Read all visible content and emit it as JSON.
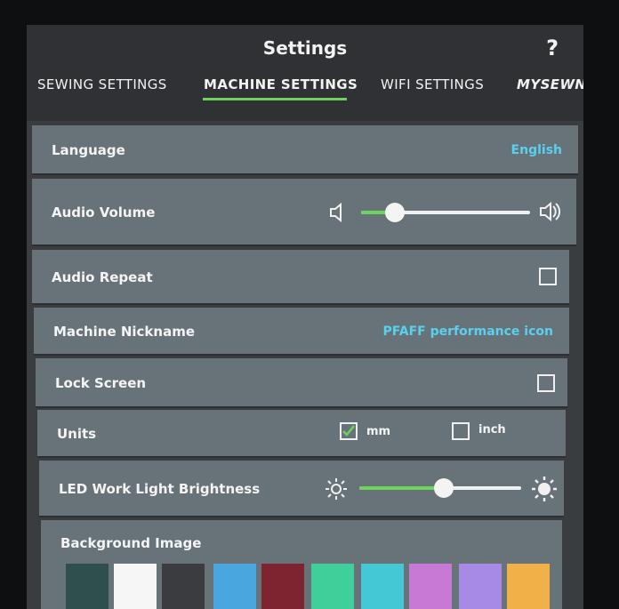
{
  "header": {
    "title": "Settings",
    "help_label": "?"
  },
  "tabs": [
    {
      "label": "SEWING SETTINGS"
    },
    {
      "label": "MACHINE SETTINGS",
      "active": true
    },
    {
      "label": "WIFI SETTINGS"
    },
    {
      "label": "MYSEWN"
    }
  ],
  "settings": {
    "language": {
      "label": "Language",
      "value": "English"
    },
    "audio_volume": {
      "label": "Audio Volume",
      "level": 0.2
    },
    "audio_repeat": {
      "label": "Audio Repeat",
      "checked": false
    },
    "machine_nickname": {
      "label": "Machine Nickname",
      "value": "PFAFF performance icon"
    },
    "lock_screen": {
      "label": "Lock Screen",
      "checked": false
    },
    "units": {
      "label": "Units",
      "options": [
        {
          "label": "mm",
          "checked": true
        },
        {
          "label": "inch",
          "checked": false
        }
      ]
    },
    "led_brightness": {
      "label": "LED Work Light Brightness",
      "level": 0.52
    },
    "background_image": {
      "label": "Background Image"
    }
  },
  "swatches": [
    "#2e4f4c",
    "#f6f6f6",
    "#3a3c3f",
    "#4aa6df",
    "#7e2330",
    "#3fcf9a",
    "#45c8d6",
    "#c67ad6",
    "#a78ae6",
    "#f0b248"
  ],
  "icons": {
    "speaker_low": "speaker-low-icon",
    "speaker_high": "speaker-high-icon",
    "brightness_low": "sun-low-icon",
    "brightness_high": "sun-high-icon"
  },
  "colors": {
    "accent": "#6cd45a",
    "value_text": "#5ad0ef",
    "row_bg": "#687379"
  }
}
